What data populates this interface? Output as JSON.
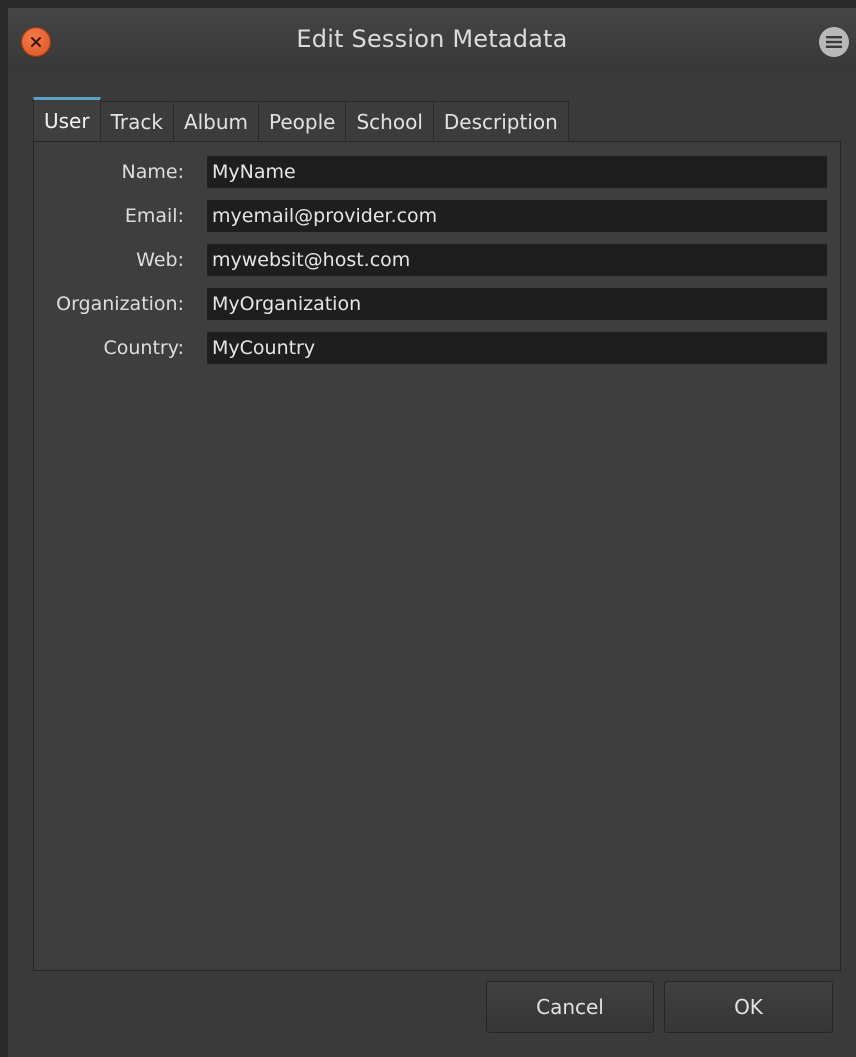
{
  "window": {
    "title": "Edit Session Metadata"
  },
  "icons": {
    "close": "close-icon",
    "menu": "menu-icon"
  },
  "colors": {
    "close_button": "#e0602a",
    "active_tab_accent": "#5aa0c8",
    "field_background": "#1e1e1e"
  },
  "tabs": [
    {
      "label": "User",
      "active": true
    },
    {
      "label": "Track",
      "active": false
    },
    {
      "label": "Album",
      "active": false
    },
    {
      "label": "People",
      "active": false
    },
    {
      "label": "School",
      "active": false
    },
    {
      "label": "Description",
      "active": false
    }
  ],
  "user": {
    "fields": [
      {
        "label": "Name:",
        "value": "MyName"
      },
      {
        "label": "Email:",
        "value": "myemail@provider.com"
      },
      {
        "label": "Web:",
        "value": "mywebsit@host.com"
      },
      {
        "label": "Organization:",
        "value": "MyOrganization"
      },
      {
        "label": "Country:",
        "value": "MyCountry"
      }
    ]
  },
  "footer": {
    "cancel_label": "Cancel",
    "ok_label": "OK"
  }
}
